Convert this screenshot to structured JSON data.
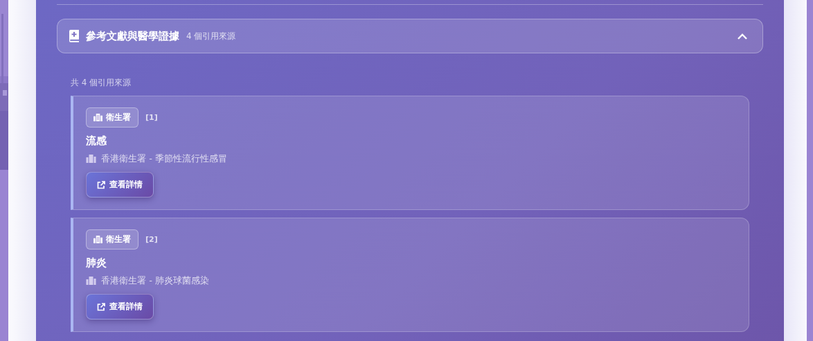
{
  "references_section": {
    "title": "參考文獻與醫學證據",
    "count": "4 個引用來源",
    "expanded": true
  },
  "summary": "共 4 個引用來源",
  "references": [
    {
      "source_tag": "衛生署",
      "index": "[1]",
      "title": "流感",
      "publisher": "香港衛生署 - 季節性流行性感冒",
      "button": "查看詳情"
    },
    {
      "source_tag": "衛生署",
      "index": "[2]",
      "title": "肺炎",
      "publisher": "香港衛生署 - 肺炎球菌感染",
      "button": "查看詳情"
    }
  ]
}
